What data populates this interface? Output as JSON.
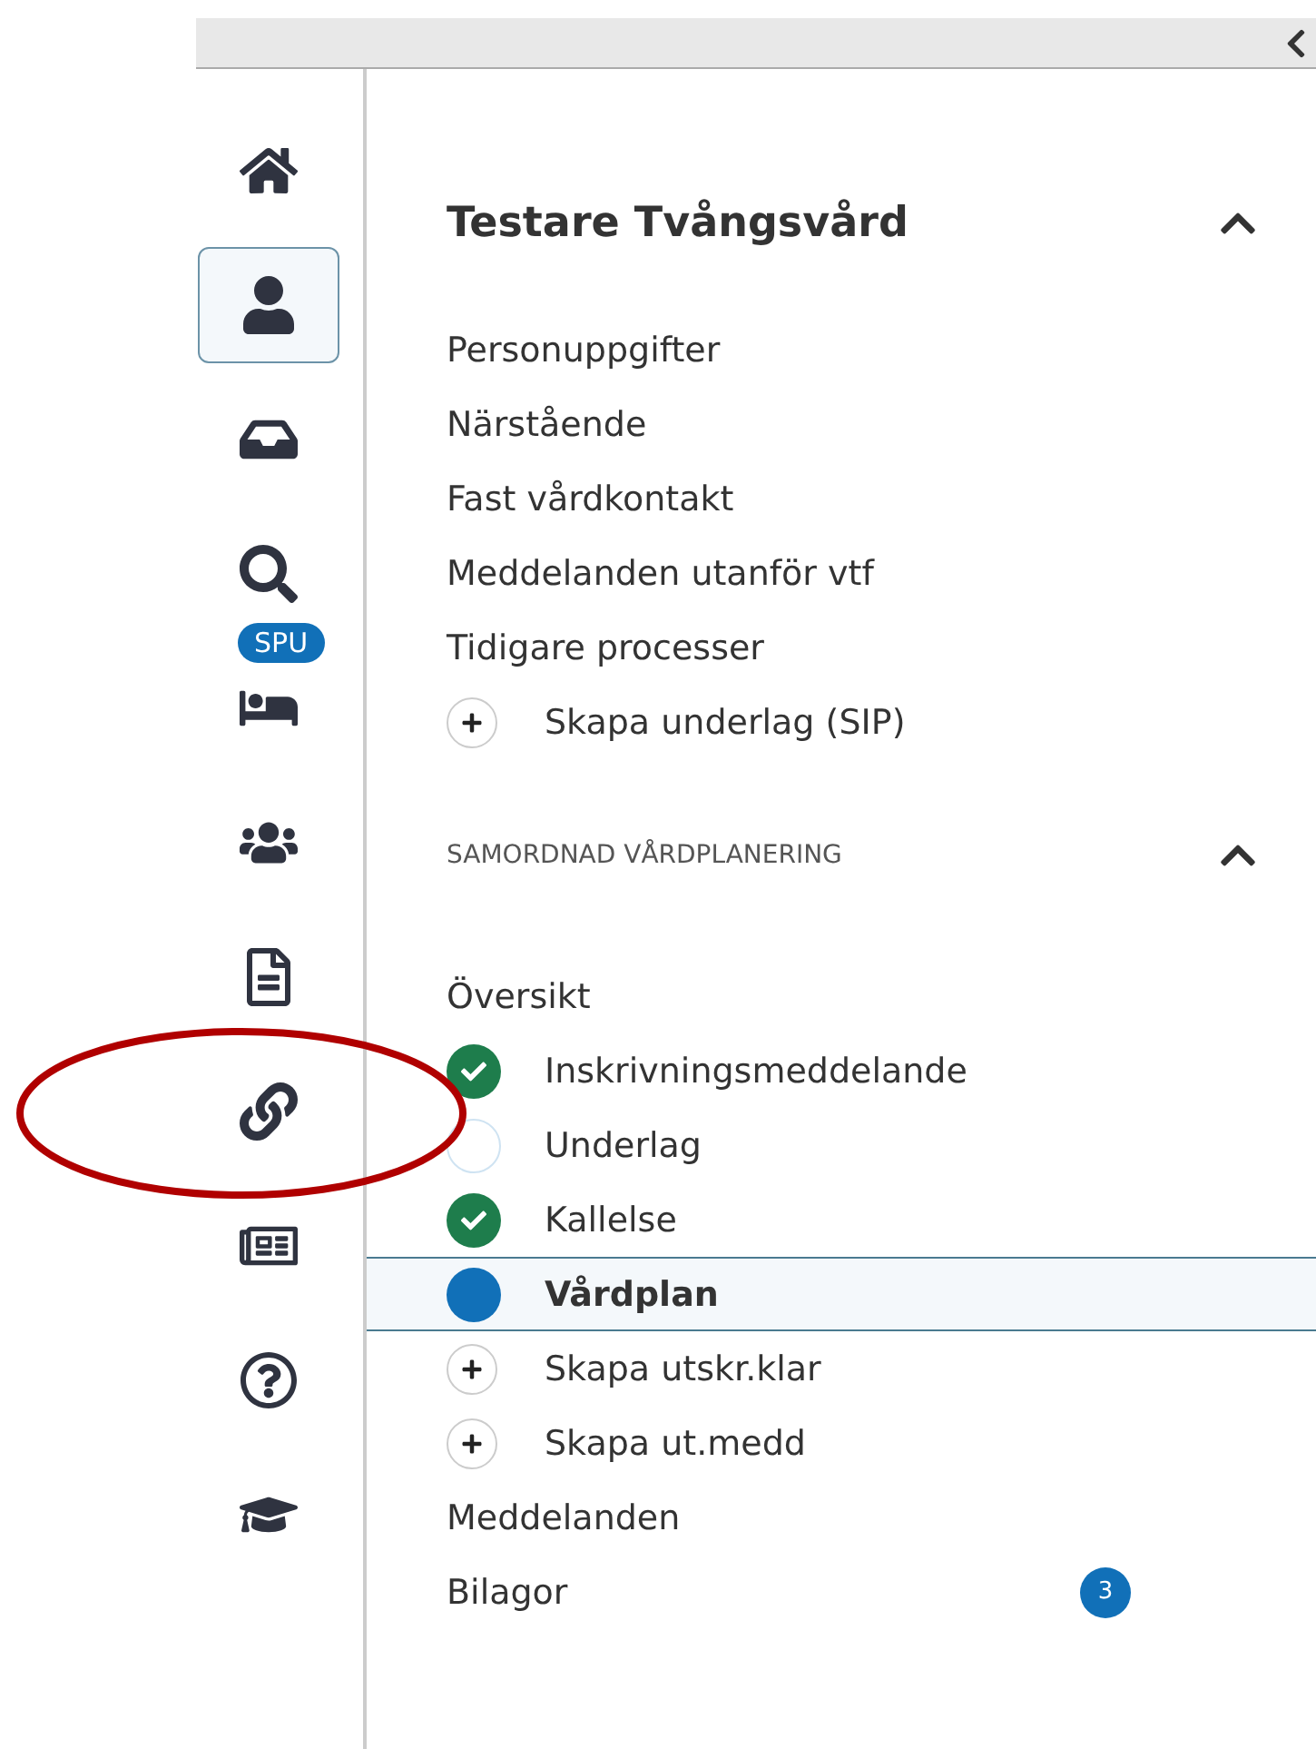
{
  "nav_rail": [
    {
      "selected": false
    },
    {
      "selected": true
    },
    {
      "selected": false
    },
    {
      "selected": false
    },
    {
      "selected": false,
      "badge": "SPU"
    },
    {
      "selected": false
    },
    {
      "selected": false
    },
    {
      "selected": false
    },
    {
      "selected": false
    },
    {
      "selected": false
    },
    {
      "selected": false
    }
  ],
  "annotation": {
    "kind": "ellipse",
    "color": "#b00000"
  },
  "patient": {
    "title": "Testare Tvångsvård",
    "expanded": true,
    "items": [
      {
        "kind": "link",
        "label": "Personuppgifter",
        "selected": false
      },
      {
        "kind": "link",
        "label": "Närstående",
        "selected": false
      },
      {
        "kind": "link",
        "label": "Fast vårdkontakt",
        "selected": false
      },
      {
        "kind": "link",
        "label": "Meddelanden utanför vtf",
        "selected": false
      },
      {
        "kind": "link",
        "label": "Tidigare processer",
        "selected": false
      },
      {
        "kind": "add",
        "label": "Skapa underlag (SIP)",
        "selected": false
      }
    ]
  },
  "section": {
    "title": "SAMORDNAD VÅRDPLANERING",
    "expanded": true,
    "items": [
      {
        "kind": "link",
        "label": "Översikt",
        "selected": false
      },
      {
        "kind": "done",
        "label": "Inskrivningsmeddelande",
        "selected": false
      },
      {
        "kind": "pending",
        "label": "Underlag",
        "selected": false
      },
      {
        "kind": "done",
        "label": "Kallelse",
        "selected": false
      },
      {
        "kind": "current",
        "label": "Vårdplan",
        "selected": true
      },
      {
        "kind": "add",
        "label": "Skapa utskr.klar",
        "selected": false
      },
      {
        "kind": "add",
        "label": "Skapa ut.medd",
        "selected": false
      },
      {
        "kind": "link",
        "label": "Meddelanden",
        "selected": false
      },
      {
        "kind": "link",
        "label": "Bilagor",
        "selected": false,
        "count": "3"
      }
    ]
  }
}
